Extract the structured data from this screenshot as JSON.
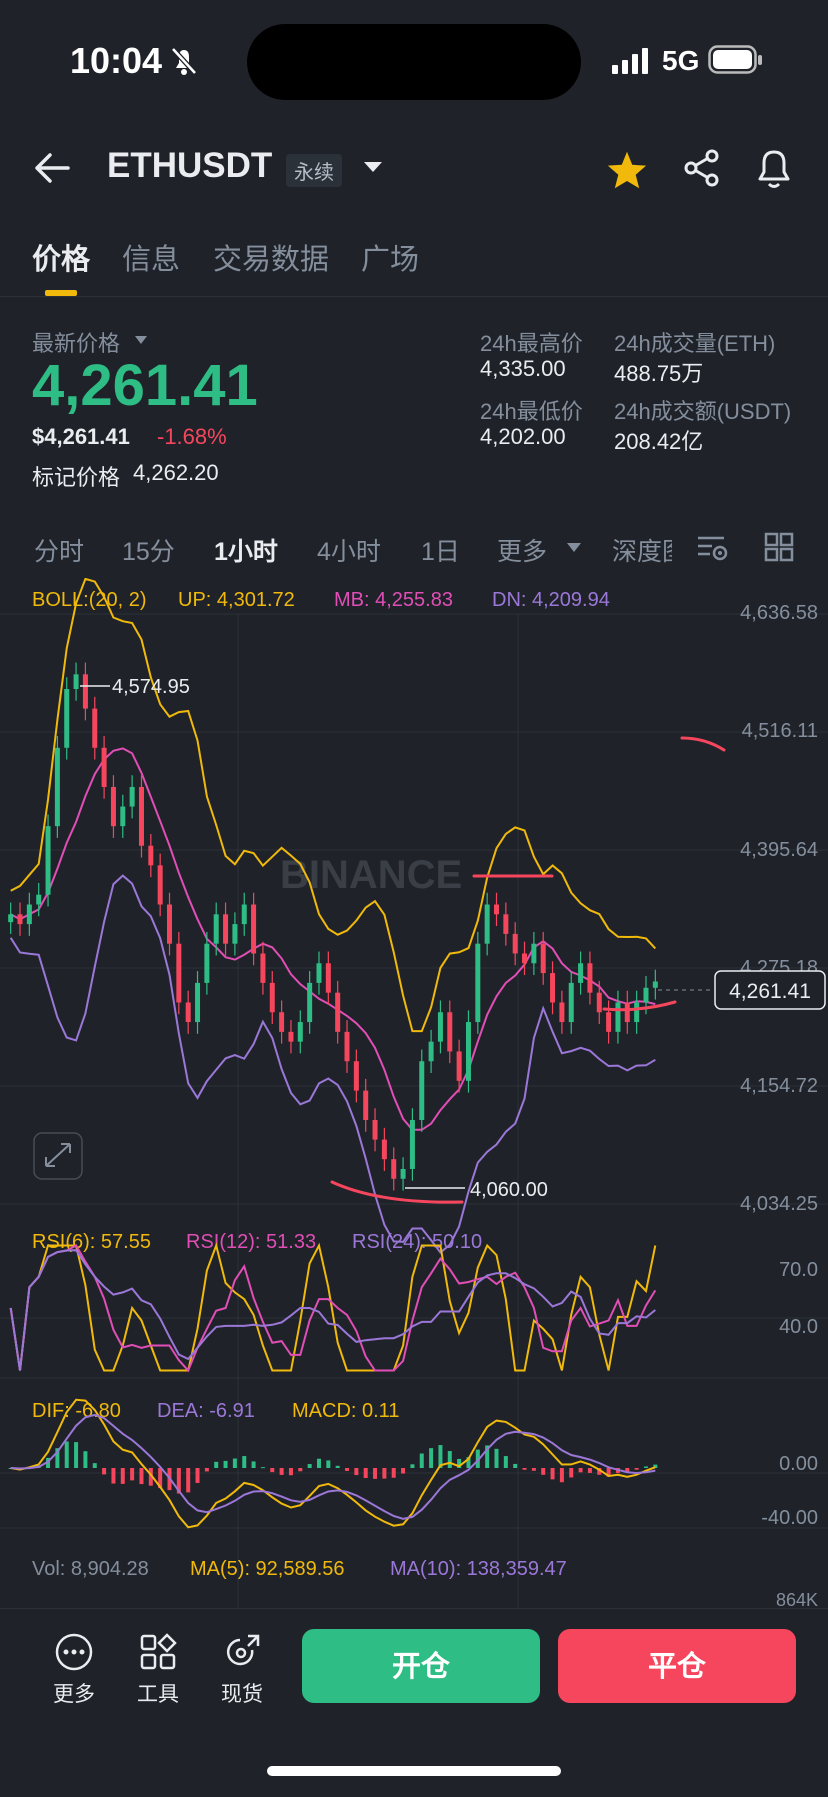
{
  "status_bar": {
    "time": "10:04",
    "network": "5G"
  },
  "header": {
    "pair": "ETHUSDT",
    "contract_type": "永续"
  },
  "tabs": [
    {
      "label": "价格",
      "active": true
    },
    {
      "label": "信息"
    },
    {
      "label": "交易数据"
    },
    {
      "label": "广场"
    }
  ],
  "price": {
    "latest_label": "最新价格",
    "latest": "4,261.41",
    "usd": "$4,261.41",
    "change": "-1.68%",
    "mark_label": "标记价格",
    "mark": "4,262.20"
  },
  "stats": {
    "high_label": "24h最高价",
    "high": "4,335.00",
    "low_label": "24h最低价",
    "low": "4,202.00",
    "vol_eth_label": "24h成交量(ETH)",
    "vol_eth": "488.75万",
    "vol_usdt_label": "24h成交额(USDT)",
    "vol_usdt": "208.42亿"
  },
  "timeframes": [
    "分时",
    "15分",
    "1小时",
    "4小时",
    "1日",
    "更多",
    "深度图"
  ],
  "active_timeframe": "1小时",
  "indicators": {
    "boll": {
      "label": "BOLL:(20, 2)",
      "up": "UP: 4,301.72",
      "mb": "MB: 4,255.83",
      "dn": "DN: 4,209.94"
    },
    "rsi": {
      "r6": "RSI(6): 57.55",
      "r12": "RSI(12): 51.33",
      "r24": "RSI(24): 50.10"
    },
    "macd": {
      "dif": "DIF: -6.80",
      "dea": "DEA: -6.91",
      "macd": "MACD: 0.11"
    },
    "vol": {
      "vol": "Vol: 8,904.28",
      "ma5": "MA(5): 92,589.56",
      "ma10": "MA(10): 138,359.47"
    }
  },
  "chart_data": {
    "type": "candlestick",
    "y_axis_ticks": [
      "4,636.58",
      "4,516.11",
      "4,395.64",
      "4,275.18",
      "4,154.72",
      "4,034.25"
    ],
    "ylim": [
      4034.25,
      4636.58
    ],
    "current_price_tag": "4,261.41",
    "high_annotation": "4,574.95",
    "low_annotation": "4,060.00",
    "close_series": [
      4330,
      4320,
      4340,
      4350,
      4420,
      4500,
      4560,
      4575,
      4540,
      4500,
      4460,
      4420,
      4440,
      4460,
      4400,
      4380,
      4340,
      4300,
      4240,
      4220,
      4260,
      4300,
      4330,
      4300,
      4320,
      4340,
      4290,
      4260,
      4230,
      4210,
      4200,
      4220,
      4260,
      4280,
      4250,
      4210,
      4180,
      4150,
      4120,
      4100,
      4080,
      4060,
      4070,
      4120,
      4180,
      4200,
      4230,
      4190,
      4160,
      4220,
      4300,
      4340,
      4330,
      4310,
      4290,
      4280,
      4300,
      4270,
      4240,
      4220,
      4260,
      4280,
      4250,
      4230,
      4210,
      4240,
      4220,
      4240,
      4255,
      4261.41
    ],
    "rsi_axis_ticks": [
      "70.0",
      "40.0"
    ],
    "macd_axis_ticks": [
      "0.00",
      "-40.00"
    ],
    "vol_axis_tick": "864K"
  },
  "colors": {
    "up": "#2ebd85",
    "down": "#f6465d",
    "accent": "#f0b90b",
    "boll_mb": "#e04eb6",
    "boll_dn": "#9b77d8"
  },
  "watermark": "BINANCE",
  "bottom_nav": [
    {
      "label": "更多",
      "icon": "more-icon"
    },
    {
      "label": "工具",
      "icon": "tools-icon"
    },
    {
      "label": "现货",
      "icon": "spot-icon"
    }
  ],
  "actions": {
    "open": "开仓",
    "close": "平仓"
  }
}
